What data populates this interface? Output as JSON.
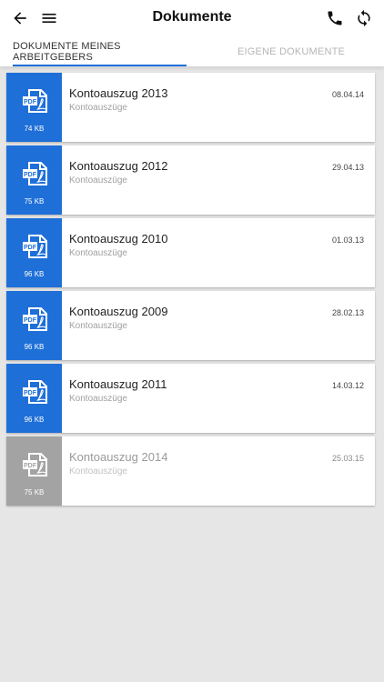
{
  "header": {
    "title": "Dokumente"
  },
  "tabs": [
    {
      "label": "DOKUMENTE MEINES ARBEITGEBERS",
      "active": true
    },
    {
      "label": "EIGENE DOKUMENTE",
      "active": false
    }
  ],
  "colors": {
    "accent": "#1f6fd8",
    "disabled": "#a3a3a3"
  },
  "icons": {
    "back": "arrow-left-icon",
    "menu": "hamburger-menu-icon",
    "call": "phone-icon",
    "refresh": "refresh-icon",
    "document": "pdf-icon"
  },
  "documents": [
    {
      "title": "Kontoauszug 2013",
      "category": "Kontoauszüge",
      "date": "08.04.14",
      "size": "74 KB",
      "disabled": false
    },
    {
      "title": "Kontoauszug 2012",
      "category": "Kontoauszüge",
      "date": "29.04.13",
      "size": "75 KB",
      "disabled": false
    },
    {
      "title": "Kontoauszug 2010",
      "category": "Kontoauszüge",
      "date": "01.03.13",
      "size": "96 KB",
      "disabled": false
    },
    {
      "title": "Kontoauszug 2009",
      "category": "Kontoauszüge",
      "date": "28.02.13",
      "size": "96 KB",
      "disabled": false
    },
    {
      "title": "Kontoauszug 2011",
      "category": "Kontoauszüge",
      "date": "14.03.12",
      "size": "96 KB",
      "disabled": false
    },
    {
      "title": "Kontoauszug 2014",
      "category": "Kontoauszüge",
      "date": "25.03.15",
      "size": "75 KB",
      "disabled": true
    }
  ]
}
